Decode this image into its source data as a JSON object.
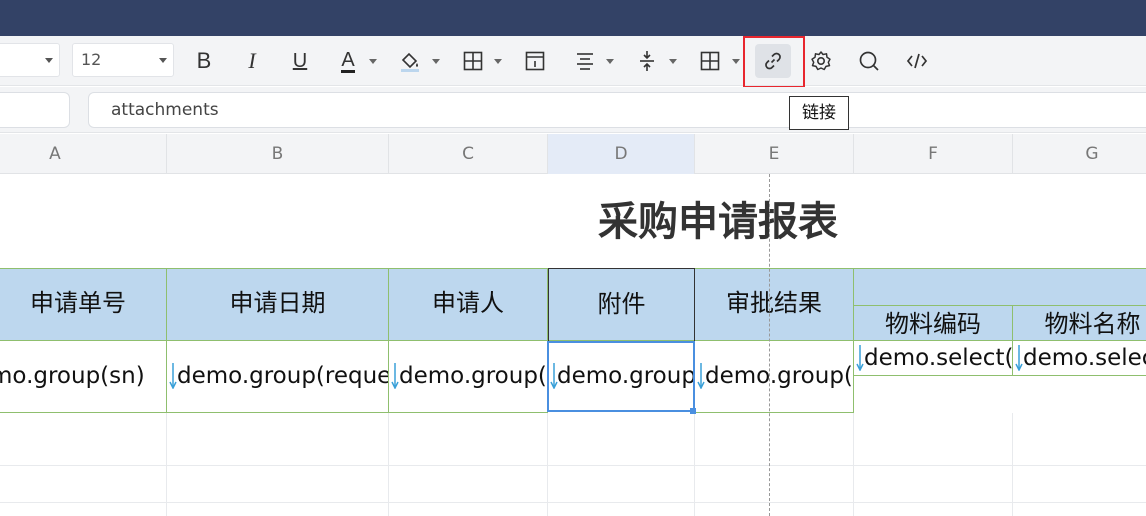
{
  "toolbar": {
    "font_size": "12",
    "bold": "B",
    "italic": "I",
    "underline": "U",
    "font_color": "A"
  },
  "tooltip": {
    "link": "链接"
  },
  "formula_bar": {
    "value": "attachments"
  },
  "columns": [
    "A",
    "B",
    "C",
    "D",
    "E",
    "F",
    "G"
  ],
  "sheet": {
    "title": "采购申请报表",
    "headers": [
      "申请单号",
      "申请日期",
      "申请人",
      "附件",
      "审批结果"
    ],
    "subheaders": [
      "物料编码",
      "物料名称"
    ],
    "row": [
      "mo.group(sn)",
      "demo.group(reque",
      "demo.group(",
      "demo.group",
      "demo.group("
    ],
    "subrow": [
      "demo.select(",
      "demo.selec"
    ]
  },
  "colors": {
    "topbar": "#334266",
    "header_fill": "#bdd7ee",
    "border_green": "#8fbf6e",
    "selection_blue": "#4a8fe0",
    "highlight_red": "#e8262e"
  }
}
